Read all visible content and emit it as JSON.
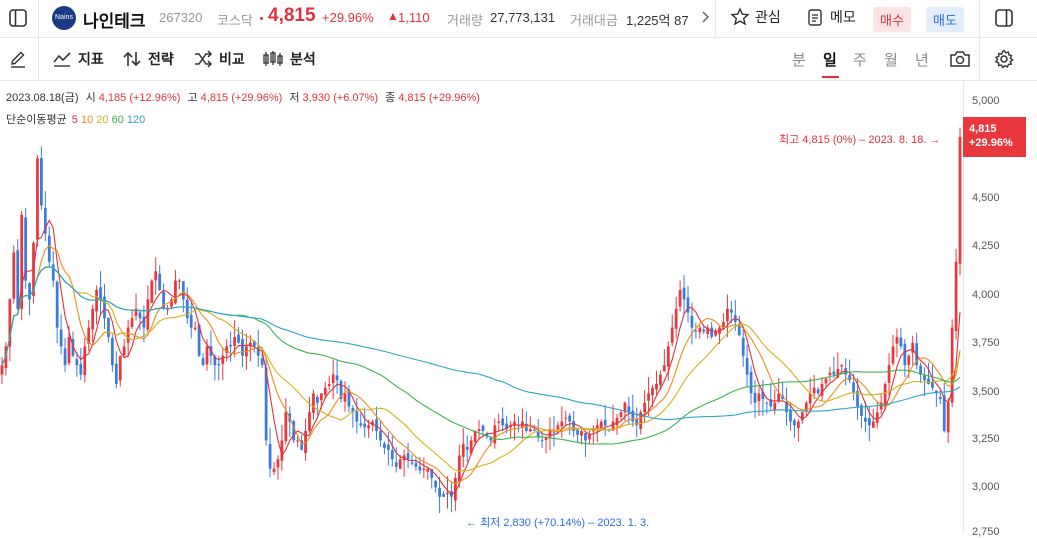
{
  "header": {
    "logo_text": "Nains",
    "stock_name": "나인테크",
    "code": "267320",
    "market": "코스닥",
    "price": "4,815",
    "change_pct": "+29.96%",
    "change_amt": "1,110",
    "volume_label": "거래량",
    "volume": "27,773,131",
    "amount_label": "거래대금",
    "amount": "1,225억 87",
    "watch_label": "관심",
    "memo_label": "메모",
    "buy_label": "매수",
    "sell_label": "매도"
  },
  "toolbar": {
    "indicator_label": "지표",
    "strategy_label": "전략",
    "compare_label": "비교",
    "analysis_label": "분석",
    "periods": [
      "분",
      "일",
      "주",
      "월",
      "년"
    ],
    "active_period": "일"
  },
  "chart_info": {
    "date": "2023.08.18(금)",
    "open_label": "시",
    "open": "4,185 (+12.96%)",
    "high_label": "고",
    "high": "4,815 (+29.96%)",
    "low_label": "저",
    "low": "3,930 (+6.07%)",
    "close_label": "종",
    "close": "4,815 (+29.96%)",
    "ma_label": "단순이동평균",
    "ma_periods": [
      "5",
      "10",
      "20",
      "60",
      "120"
    ],
    "ma_colors": [
      "#e0323c",
      "#f08c1a",
      "#d4b21a",
      "#3cb44b",
      "#2aa7c9"
    ]
  },
  "annotations": {
    "high": "최고 4,815 (0%) – 2023. 8. 18.",
    "low": "최저 2,830 (+70.14%) – 2023. 1. 3."
  },
  "price_box": {
    "price": "4,815",
    "pct": "+29.96%"
  },
  "chart_data": {
    "type": "candlestick",
    "y_ticks": [
      "5,000",
      "4,750",
      "4,500",
      "4,250",
      "4,000",
      "3,750",
      "3,500",
      "3,250",
      "3,000",
      "2,750"
    ],
    "ylim": [
      2750,
      5000
    ],
    "colors": {
      "up": "#e8383d",
      "down": "#3a7be0"
    },
    "close_series": [
      3600,
      3700,
      3950,
      4200,
      3900,
      4400,
      4050,
      3950,
      4250,
      4700,
      4450,
      4300,
      4150,
      4050,
      3800,
      3700,
      3600,
      3750,
      3650,
      3600,
      3550,
      3700,
      3800,
      3900,
      4000,
      3950,
      3850,
      3750,
      3600,
      3500,
      3650,
      3700,
      3800,
      3850,
      3900,
      3850,
      3800,
      3950,
      4050,
      4100,
      4000,
      3900,
      3900,
      3950,
      4050,
      4050,
      3950,
      3850,
      3800,
      3800,
      3650,
      3600,
      3700,
      3650,
      3600,
      3600,
      3650,
      3700,
      3700,
      3750,
      3720,
      3650,
      3700,
      3720,
      3700,
      3650,
      3600,
      3200,
      3050,
      3050,
      3100,
      3200,
      3350,
      3300,
      3200,
      3200,
      3150,
      3250,
      3350,
      3450,
      3400,
      3450,
      3480,
      3500,
      3550,
      3520,
      3420,
      3450,
      3380,
      3350,
      3300,
      3280,
      3270,
      3280,
      3300,
      3250,
      3200,
      3160,
      3150,
      3100,
      3060,
      3100,
      3120,
      3100,
      3080,
      3060,
      3040,
      3050,
      3050,
      3000,
      2950,
      2900,
      2900,
      2920,
      2900,
      3000,
      3120,
      3180,
      3150,
      3200,
      3250,
      3260,
      3250,
      3220,
      3200,
      3280,
      3300,
      3280,
      3260,
      3280,
      3300,
      3280,
      3300,
      3250,
      3260,
      3250,
      3220,
      3200,
      3220,
      3260,
      3240,
      3280,
      3300,
      3320,
      3300,
      3250,
      3230,
      3250,
      3200,
      3230,
      3260,
      3280,
      3300,
      3280,
      3260,
      3300,
      3320,
      3350,
      3400,
      3350,
      3300,
      3280,
      3350,
      3400,
      3450,
      3480,
      3500,
      3550,
      3600,
      3700,
      3800,
      3900,
      4000,
      3950,
      3880,
      3800,
      3780,
      3800,
      3780,
      3800,
      3750,
      3780,
      3800,
      3830,
      3900,
      3880,
      3830,
      3760,
      3650,
      3550,
      3450,
      3400,
      3450,
      3420,
      3400,
      3380,
      3400,
      3450,
      3420,
      3350,
      3300,
      3280,
      3300,
      3350,
      3400,
      3450,
      3480,
      3450,
      3500,
      3530,
      3560,
      3550,
      3580,
      3600,
      3550,
      3520,
      3450,
      3380,
      3330,
      3300,
      3280,
      3300,
      3350,
      3400,
      3500,
      3600,
      3700,
      3750,
      3700,
      3600,
      3650,
      3720,
      3600,
      3550,
      3520,
      3500,
      3480,
      3450,
      3420,
      3250,
      3400,
      3800,
      4150,
      4815
    ]
  }
}
